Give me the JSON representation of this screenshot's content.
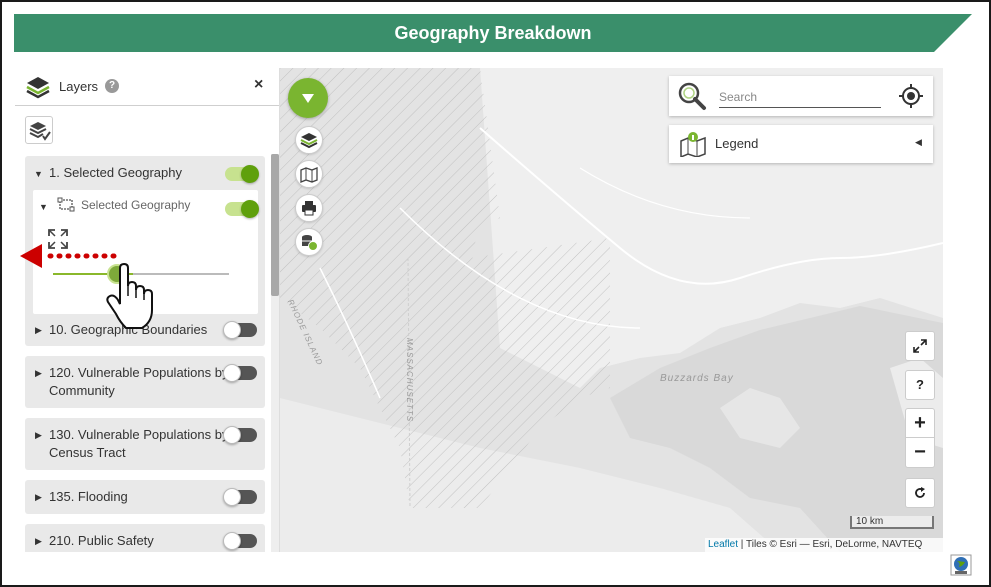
{
  "banner": {
    "title": "Geography Breakdown",
    "color": "#3a8f6b"
  },
  "layers_panel": {
    "title": "Layers",
    "groups": [
      {
        "label": "1. Selected Geography",
        "on": true,
        "sub": {
          "label": "Selected Geography",
          "on": true,
          "opacity": 0.4
        }
      },
      {
        "label": "10. Geographic Boundaries",
        "on": false
      },
      {
        "label": "120. Vulnerable Populations by",
        "label2": "Community",
        "on": false
      },
      {
        "label": "130. Vulnerable Populations by",
        "label2": "Census Tract",
        "on": false
      },
      {
        "label": "135. Flooding",
        "on": false
      },
      {
        "label": "210. Public Safety",
        "on": false
      }
    ]
  },
  "map": {
    "labels": {
      "bay": "Buzzards Bay",
      "state1": "RHODE ISLAND",
      "state2": "MASSACHUSETTS"
    },
    "search": {
      "placeholder": "Search"
    },
    "legend": {
      "label": "Legend"
    },
    "help_label": "?",
    "zoom": {
      "in": "+",
      "out": "−"
    },
    "scale": "10 km",
    "attribution": {
      "leaflet": "Leaflet",
      "rest": " | Tiles © Esri — Esri, DeLorme, NAVTEQ"
    }
  },
  "colors": {
    "accent": "#7ab530",
    "arrow": "#cc0000"
  },
  "icons": [
    "layers-icon",
    "help-icon",
    "close-icon",
    "layer-tools-icon",
    "fullscreen-icon",
    "search-icon",
    "locate-icon",
    "legend-icon",
    "print-icon",
    "database-globe-icon",
    "reset-icon",
    "globe-icon",
    "hand-cursor-icon"
  ]
}
